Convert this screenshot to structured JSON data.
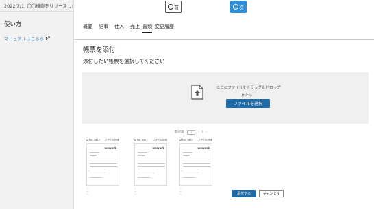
{
  "sidebar": {
    "news": "2022/2/1: 〇〇機能をリリースしました！",
    "heading": "使い方",
    "manual_link": "マニュアルはこちら"
  },
  "nav": {
    "prev_label": "前",
    "next_label": "次"
  },
  "tabs": [
    {
      "label": "概要"
    },
    {
      "label": "記事"
    },
    {
      "label": "仕入"
    },
    {
      "label": "売上"
    },
    {
      "label": "書類",
      "active": true
    },
    {
      "label": "変更履歴"
    }
  ],
  "main": {
    "title": "帳票を添付",
    "instruction": "添付したい帳票を選択してください"
  },
  "dropzone": {
    "drag_text": "ここにファイルをドラッグ＆ドロップ",
    "or_text": "または",
    "select_button": "ファイルを選択"
  },
  "preview": {
    "pager_label": "表示件数",
    "pager_left": "1",
    "pager_right": "1",
    "docs": [
      {
        "number": "No. 3645",
        "link": "ファイル詳細",
        "brand": "wework"
      },
      {
        "number": "No. 3677",
        "link": "ファイル詳細",
        "brand": "wework"
      },
      {
        "number": "No. 3662",
        "link": "ファイル詳細",
        "brand": "wework"
      }
    ]
  },
  "actions": {
    "attach": "添付する",
    "cancel": "キャンセル"
  },
  "colors": {
    "primary": "#1f6aa5",
    "next_button": "#2e8fd8",
    "link": "#3a8bd4",
    "sidebar_bg": "#f2f2f2",
    "dropzone_bg": "#f0f0f0"
  }
}
